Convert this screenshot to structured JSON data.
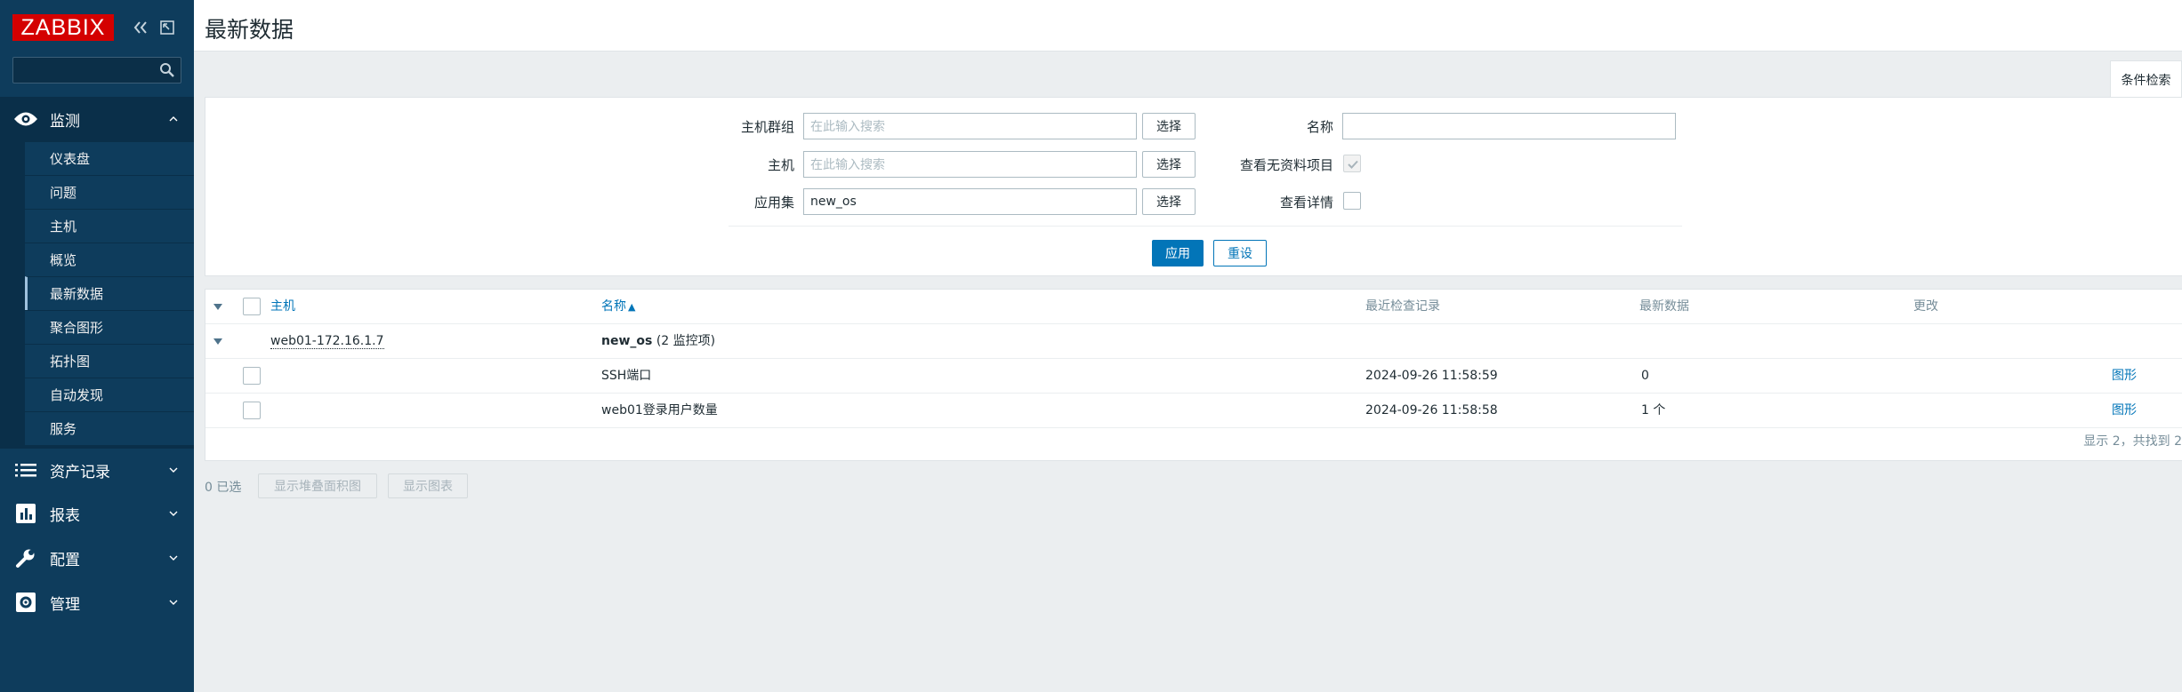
{
  "app": {
    "logo_text": "ZABBIX"
  },
  "sidebar": {
    "search_placeholder": "",
    "sections": [
      {
        "label": "监测",
        "icon": "eye-icon",
        "expanded": true
      },
      {
        "label": "资产记录",
        "icon": "list-icon"
      },
      {
        "label": "报表",
        "icon": "bar-chart-icon"
      },
      {
        "label": "配置",
        "icon": "wrench-icon"
      },
      {
        "label": "管理",
        "icon": "gear-icon"
      }
    ],
    "monitor_items": [
      "仪表盘",
      "问题",
      "主机",
      "概览",
      "最新数据",
      "聚合图形",
      "拓扑图",
      "自动发现",
      "服务"
    ],
    "active_item": "最新数据"
  },
  "header": {
    "title": "最新数据"
  },
  "filter": {
    "tab_label": "条件检索",
    "host_group_label": "主机群组",
    "host_group_placeholder": "在此输入搜索",
    "host_label": "主机",
    "host_placeholder": "在此输入搜索",
    "application_label": "应用集",
    "application_value": "new_os",
    "select_label": "选择",
    "name_label": "名称",
    "name_value": "",
    "show_without_data_label": "查看无资料项目",
    "show_without_data_checked": true,
    "show_details_label": "查看详情",
    "show_details_checked": false,
    "apply_label": "应用",
    "reset_label": "重设"
  },
  "table": {
    "columns": {
      "host": "主机",
      "name": "名称",
      "last_check": "最近检查记录",
      "last_value": "最新数据",
      "change": "更改"
    },
    "sort_indicator": "▲",
    "group": {
      "host": "web01-172.16.1.7",
      "app": "new_os",
      "count": "(2 监控项)"
    },
    "rows": [
      {
        "name": "SSH端口",
        "last_check": "2024-09-26 11:58:59",
        "last_value": "0",
        "action": "图形"
      },
      {
        "name": "web01登录用户数量",
        "last_check": "2024-09-26 11:58:58",
        "last_value": "1 个",
        "action": "图形"
      }
    ],
    "footer": "显示 2，共找到 2"
  },
  "actions": {
    "selected": "0 已选",
    "stacked_graph": "显示堆叠面积图",
    "graph": "显示图表"
  },
  "colors": {
    "sidebar": "#0e3c5c",
    "logo": "#d40000",
    "accent": "#0275b8"
  }
}
